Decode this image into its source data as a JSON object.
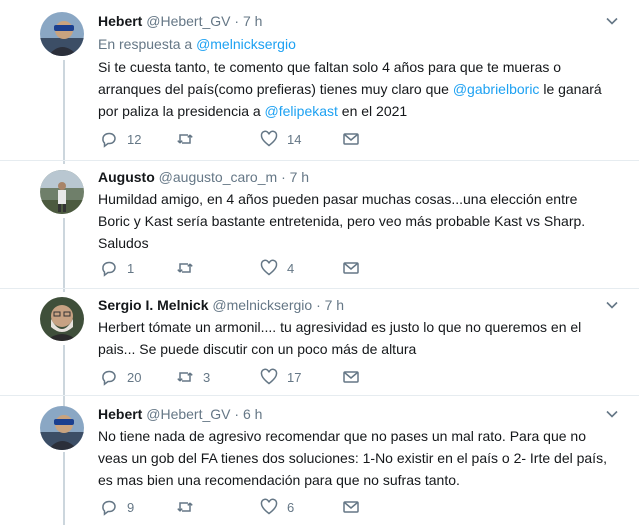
{
  "tweets": [
    {
      "name": "Hebert",
      "handle": "@Hebert_GV",
      "time": "· 7 h",
      "reply_prefix": "En respuesta a",
      "reply_handle": "@melnicksergio",
      "body": [
        {
          "t": "Si te cuesta tanto, te comento que faltan solo 4 años para que te mueras o arranques del país(como prefieras) tienes muy claro que "
        },
        {
          "t": "@gabrielboric",
          "link": true
        },
        {
          "t": " le ganará por paliza la presidencia a "
        },
        {
          "t": "@felipekast",
          "link": true
        },
        {
          "t": "  en el 2021"
        }
      ],
      "replies": "12",
      "retweets": "",
      "likes": "14"
    },
    {
      "name": "Augusto",
      "handle": "@augusto_caro_m",
      "time": "· 7 h",
      "body": [
        {
          "t": "Humildad amigo, en 4 años pueden pasar muchas cosas...una elección entre Boric  y Kast sería bastante entretenida, pero veo más probable Kast vs Sharp. Saludos"
        }
      ],
      "replies": "1",
      "retweets": "",
      "likes": "4"
    },
    {
      "name": "Sergio I. Melnick",
      "handle": "@melnicksergio",
      "time": "· 7 h",
      "body": [
        {
          "t": "Herbert tómate un armonil.... tu agresividad es justo lo que no queremos en el pais... Se puede discutir con un poco más de altura"
        }
      ],
      "replies": "20",
      "retweets": "3",
      "likes": "17"
    },
    {
      "name": "Hebert",
      "handle": "@Hebert_GV",
      "time": "· 6 h",
      "body": [
        {
          "t": "No tiene nada de agresivo recomendar que no pases un mal rato. Para que no veas un gob del FA tienes dos soluciones: 1-No existir en el país o 2- Irte del país, es mas bien una recomendación para que no sufras tanto."
        }
      ],
      "replies": "9",
      "retweets": "",
      "likes": "6"
    }
  ],
  "colors": {
    "link": "#1da1f2",
    "meta": "#657786",
    "text": "#14171a",
    "thread_line": "#ccd6dd",
    "divider": "#e6ecf0"
  }
}
